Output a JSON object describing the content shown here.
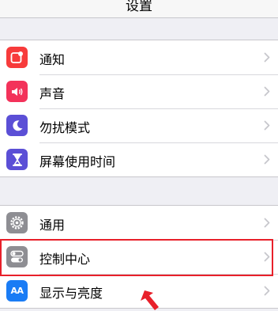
{
  "header": {
    "title": "设置"
  },
  "groups": [
    {
      "items": [
        {
          "label": "通知",
          "icon": "notifications-icon",
          "color": "#f73b3b"
        },
        {
          "label": "声音",
          "icon": "sounds-icon",
          "color": "#f3325a"
        },
        {
          "label": "勿扰模式",
          "icon": "moon-icon",
          "color": "#5b4fd6"
        },
        {
          "label": "屏幕使用时间",
          "icon": "hourglass-icon",
          "color": "#5b4fd6"
        }
      ]
    },
    {
      "items": [
        {
          "label": "通用",
          "icon": "gear-icon",
          "color": "#8e8e93"
        },
        {
          "label": "控制中心",
          "icon": "toggles-icon",
          "color": "#8e8e93"
        },
        {
          "label": "显示与亮度",
          "icon": "text-size-icon",
          "color": "#1a7cf5",
          "icon_text": "AA"
        }
      ]
    }
  ],
  "annotation": {
    "highlight_color": "#e8202a"
  }
}
